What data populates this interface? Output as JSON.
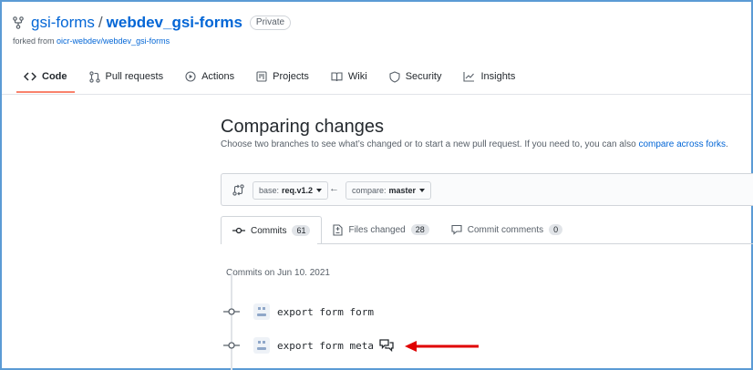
{
  "repo": {
    "owner": "gsi-forms",
    "separator": "/",
    "name": "webdev_gsi-forms",
    "visibility": "Private",
    "forked_prefix": "forked from ",
    "forked_from": "oicr-webdev/webdev_gsi-forms"
  },
  "nav": {
    "items": [
      {
        "label": "Code",
        "icon": "code-icon"
      },
      {
        "label": "Pull requests",
        "icon": "pull-request-icon"
      },
      {
        "label": "Actions",
        "icon": "play-icon"
      },
      {
        "label": "Projects",
        "icon": "project-icon"
      },
      {
        "label": "Wiki",
        "icon": "book-icon"
      },
      {
        "label": "Security",
        "icon": "shield-icon"
      },
      {
        "label": "Insights",
        "icon": "graph-icon"
      }
    ],
    "active": "Code"
  },
  "compare": {
    "title": "Comparing changes",
    "subtitle_text": "Choose two branches to see what’s changed or to start a new pull request. If you need to, you can also ",
    "subtitle_link": "compare across forks",
    "subtitle_end": ".",
    "base_label": "base:",
    "base_value": "req.v1.2",
    "compare_label": "compare:",
    "compare_value": "master",
    "arrow": "←"
  },
  "tabs": [
    {
      "label": "Commits",
      "count": "61",
      "icon": "commit-icon"
    },
    {
      "label": "Files changed",
      "count": "28",
      "icon": "file-diff-icon"
    },
    {
      "label": "Commit comments",
      "count": "0",
      "icon": "comment-icon"
    }
  ],
  "commits_partial_header": "Commits on Jun 10, 2021",
  "commits": [
    {
      "message": "export form form"
    },
    {
      "message": "export form meta"
    }
  ],
  "colors": {
    "link": "#0366d6",
    "active_underline": "#f9826c",
    "annotation_arrow": "#e00000",
    "frame": "#5b9bd5"
  }
}
